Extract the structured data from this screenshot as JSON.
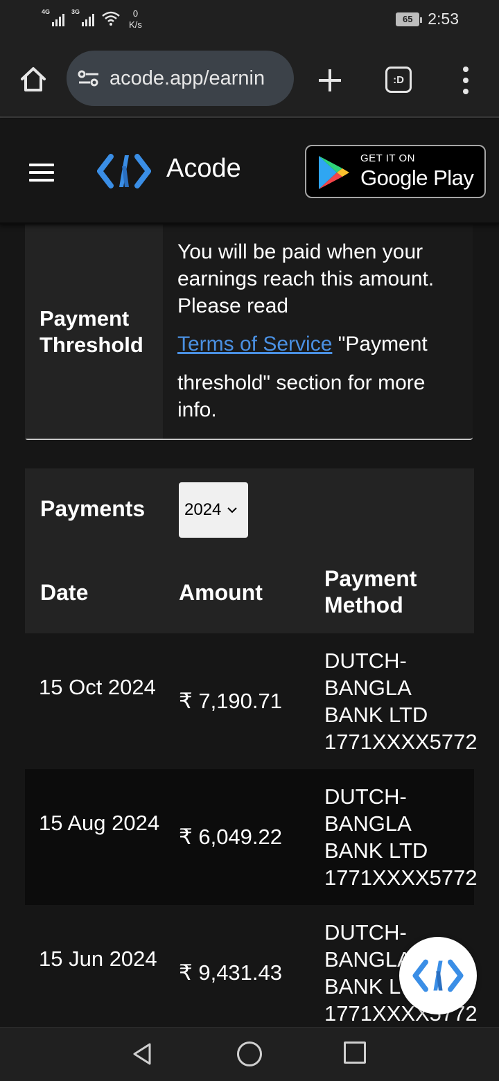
{
  "status_bar": {
    "signal1_label": "4G",
    "signal2_label": "3G",
    "net_speed_value": "0",
    "net_speed_unit": "K/s",
    "battery": "65",
    "time": "2:53"
  },
  "browser": {
    "url": "acode.app/earnin",
    "tabs_label": ":D"
  },
  "header": {
    "brand": "Acode",
    "play_small": "GET IT ON",
    "play_big": "Google Play"
  },
  "threshold": {
    "label": "Payment Threshold",
    "text_before": "You will be paid when your earnings reach this amount. Please read",
    "link": "Terms of Service",
    "text_after": " \"Payment threshold\" section for more info."
  },
  "payments": {
    "title": "Payments",
    "year": "2024",
    "headers": {
      "date": "Date",
      "amount": "Amount",
      "method": "Payment Method"
    },
    "rows": [
      {
        "date": "15 Oct 2024",
        "amount": "₹ 7,190.71",
        "method": "DUTCH-BANGLA BANK LTD 1771XXXX5772"
      },
      {
        "date": "15 Aug 2024",
        "amount": "₹ 6,049.22",
        "method": "DUTCH-BANGLA BANK LTD 1771XXXX5772"
      },
      {
        "date": "15 Jun 2024",
        "amount": "₹ 9,431.43",
        "method": "DUTCH-BANGLA BANK LTD 1771XXXX5772"
      }
    ]
  },
  "icons": {
    "home": "home-icon",
    "site_settings": "tune-icon",
    "new_tab": "plus-icon",
    "more": "more-vert-icon",
    "menu": "hamburger-icon",
    "logo": "acode-logo-icon",
    "play": "google-play-icon",
    "nav_back": "back-triangle-icon",
    "nav_home": "home-circle-icon",
    "nav_recent": "recent-square-icon"
  },
  "colors": {
    "accent": "#4a90e2",
    "logo_blue": "#3a8ee6",
    "page_bg": "#161616",
    "card_bg": "#232323"
  }
}
